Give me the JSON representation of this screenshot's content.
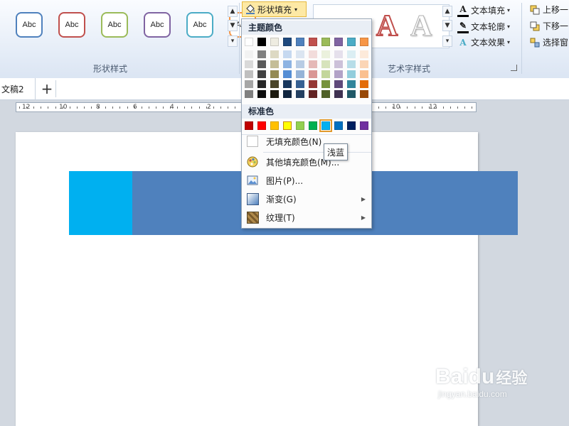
{
  "ribbon": {
    "shape_styles": {
      "label": "形状样式",
      "items": [
        {
          "label": "Abc",
          "color": "#4f81bd"
        },
        {
          "label": "Abc",
          "color": "#c0504d"
        },
        {
          "label": "Abc",
          "color": "#9bbb59"
        },
        {
          "label": "Abc",
          "color": "#8064a2"
        },
        {
          "label": "Abc",
          "color": "#4bacc6"
        },
        {
          "label": "Abc",
          "color": "#f79646"
        }
      ]
    },
    "shape_fill": {
      "label": "形状填充"
    },
    "art_styles": {
      "label": "艺术字样式",
      "glyph": "A",
      "text_fill": "文本填充",
      "text_outline": "文本轮廓",
      "text_effects": "文本效果"
    },
    "arrange": {
      "bring_forward": "上移一",
      "send_backward": "下移一",
      "selection_pane": "选择窗"
    }
  },
  "tabs": {
    "doc_tab": "文稿2",
    "new_tab": "+"
  },
  "ruler": {
    "labels": [
      "12",
      "10",
      "8",
      "6",
      "4",
      "2",
      "2",
      "4",
      "6",
      "8",
      "10",
      "12"
    ]
  },
  "menu": {
    "theme_header": "主题颜色",
    "standard_header": "标准色",
    "theme_colors": [
      {
        "base": "#ffffff",
        "shades": [
          "#f2f2f2",
          "#d9d9d9",
          "#bfbfbf",
          "#a6a6a6",
          "#808080"
        ]
      },
      {
        "base": "#000000",
        "shades": [
          "#7f7f7f",
          "#595959",
          "#404040",
          "#262626",
          "#0d0d0d"
        ]
      },
      {
        "base": "#eeece1",
        "shades": [
          "#ddd9c3",
          "#c4bd97",
          "#948a54",
          "#4a452a",
          "#1d1b10"
        ]
      },
      {
        "base": "#1f497d",
        "shades": [
          "#c6d9f0",
          "#8db3e2",
          "#548dd4",
          "#17365d",
          "#0f243e"
        ]
      },
      {
        "base": "#4f81bd",
        "shades": [
          "#dbe5f1",
          "#b8cce4",
          "#95b3d7",
          "#366092",
          "#244061"
        ]
      },
      {
        "base": "#c0504d",
        "shades": [
          "#f2dcdb",
          "#e5b9b7",
          "#d99694",
          "#953734",
          "#632423"
        ]
      },
      {
        "base": "#9bbb59",
        "shades": [
          "#ebf1dd",
          "#d7e3bc",
          "#c3d69b",
          "#76923c",
          "#4f6128"
        ]
      },
      {
        "base": "#8064a2",
        "shades": [
          "#e5e0ec",
          "#ccc1d9",
          "#b2a2c7",
          "#5f497a",
          "#3f3151"
        ]
      },
      {
        "base": "#4bacc6",
        "shades": [
          "#dbeef3",
          "#b7dde8",
          "#92cddc",
          "#31859b",
          "#205867"
        ]
      },
      {
        "base": "#f79646",
        "shades": [
          "#fdeada",
          "#fbd5b5",
          "#fac08f",
          "#e36c09",
          "#974806"
        ]
      }
    ],
    "standard_colors": [
      "#c00000",
      "#ff0000",
      "#ffc000",
      "#ffff00",
      "#92d050",
      "#00b050",
      "#00b0f0",
      "#0070c0",
      "#002060",
      "#7030a0"
    ],
    "selected_standard_index": 6,
    "outlined_standard_index": 3,
    "items": {
      "no_fill": "无填充颜色(N)",
      "more_colors": "其他填充颜色(M)...",
      "picture": "图片(P)...",
      "gradient": "渐变(G)",
      "texture": "纹理(T)"
    }
  },
  "tooltip": {
    "text": "浅蓝"
  },
  "shapes": {
    "left_color": "#00b0f0",
    "right_color": "#4f81bd"
  },
  "watermark": {
    "brand": "Baidu",
    "brand_cn": "经验",
    "url": "jingyan.baidu.com"
  }
}
